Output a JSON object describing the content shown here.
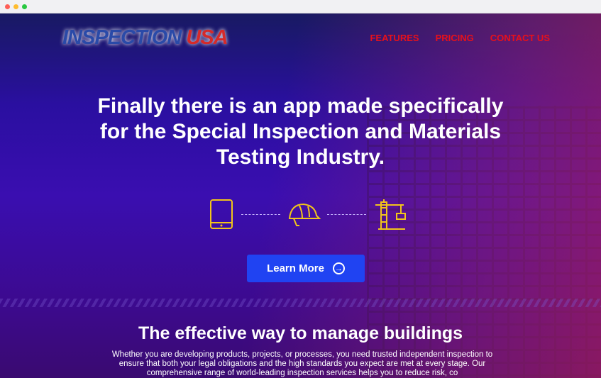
{
  "brand": {
    "logo_part1": "INSPECTION",
    "logo_part2": "USA"
  },
  "nav": [
    "FEATURES",
    "PRICING",
    "CONTACT US"
  ],
  "hero": {
    "headline": "Finally there is an app made specifically for the Special Inspection and Materials Testing Industry.",
    "icons": [
      "tablet-icon",
      "hard-hat-icon",
      "crane-icon"
    ],
    "cta": "Learn More"
  },
  "section": {
    "title": "The effective way to manage buildings",
    "body": "Whether you are developing products, projects, or processes, you need trusted independent inspection to ensure that both your legal obligations and the high standards you expect are met at every stage. Our comprehensive range of world-leading inspection services helps you to reduce risk, co"
  },
  "colors": {
    "nav": "#e8101a",
    "button": "#2043f2",
    "icons": "#f2c51a"
  }
}
